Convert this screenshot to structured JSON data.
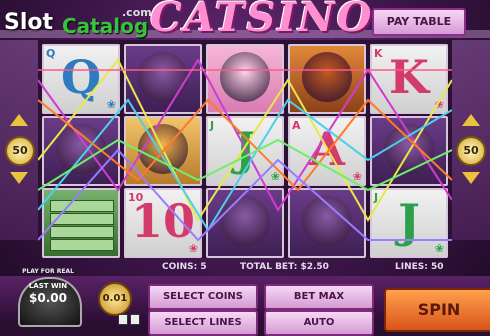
{
  "brand": {
    "slot": "Slot",
    "catalog": "Catalog",
    "com": ".com"
  },
  "title": "CATSINO",
  "paytable_label": "PAY TABLE",
  "lines_indicator": {
    "left": "50",
    "right": "50"
  },
  "reels": [
    [
      {
        "type": "card",
        "letter": "Q",
        "color": "#2e7bbf",
        "corner": "Q"
      },
      {
        "type": "cat",
        "color": "#6c3c8a"
      },
      {
        "type": "cash"
      }
    ],
    [
      {
        "type": "cat",
        "color": "#6c3c8a"
      },
      {
        "type": "blonde"
      },
      {
        "type": "card",
        "letter": "10",
        "color": "#d23b6a",
        "corner": "10"
      }
    ],
    [
      {
        "type": "pink"
      },
      {
        "type": "card",
        "letter": "J",
        "color": "#2da04a",
        "corner": "J"
      },
      {
        "type": "cat",
        "color": "#6c3c8a"
      }
    ],
    [
      {
        "type": "orange"
      },
      {
        "type": "card",
        "letter": "A",
        "color": "#d23b6a",
        "corner": "A"
      },
      {
        "type": "cat",
        "color": "#6c3c8a"
      }
    ],
    [
      {
        "type": "card",
        "letter": "K",
        "color": "#d23b6a",
        "corner": "K"
      },
      {
        "type": "cat",
        "color": "#6c3c8a"
      },
      {
        "type": "card",
        "letter": "J",
        "color": "#2da04a",
        "corner": "J"
      }
    ]
  ],
  "status": {
    "coins_label": "COINS:",
    "coins_value": "5",
    "total_bet_label": "TOTAL BET:",
    "total_bet_value": "$2.50",
    "lines_label": "LINES:",
    "lines_value": "50"
  },
  "controls": {
    "play_for_real": "PLAY FOR REAL",
    "last_win_label": "LAST WIN",
    "last_win_value": "$0.00",
    "coin_value": "0.01",
    "select_coins": "SELECT COINS",
    "bet_max": "BET MAX",
    "select_lines": "SELECT LINES",
    "auto": "AUTO",
    "spin": "SPIN"
  },
  "colors": {
    "accent_pink": "#ff8fd0",
    "spin_orange": "#ff8c3c",
    "button_border": "#7e2a7c"
  }
}
